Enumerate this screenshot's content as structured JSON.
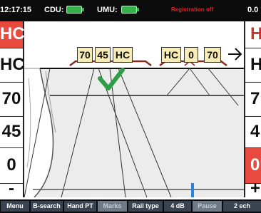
{
  "status": {
    "time": "12:17:15",
    "cdu_label": "CDU:",
    "umu_label": "UMU:",
    "registration": "Registration off",
    "right_value": "0.0",
    "colors": {
      "bar_bg": "#0c0c0c",
      "battery": "#32b44b",
      "registration_text": "#e02424"
    }
  },
  "left_channels": [
    {
      "label": "HC",
      "selected": true
    },
    {
      "label": "HC",
      "selected": false
    },
    {
      "label": "70",
      "selected": false
    },
    {
      "label": "45",
      "selected": false
    },
    {
      "label": "0",
      "selected": false
    },
    {
      "label": "-",
      "selected": false
    }
  ],
  "right_channels": [
    {
      "label": "H",
      "selected": false
    },
    {
      "label": "H",
      "selected": false
    },
    {
      "label": "7",
      "selected": false
    },
    {
      "label": "4",
      "selected": false
    },
    {
      "label": "0",
      "selected": true
    },
    {
      "label": "+",
      "selected": false
    }
  ],
  "scan": {
    "left_group_tags": [
      "70",
      "45",
      "HC"
    ],
    "right_group_tags": [
      "HC",
      "0",
      "70"
    ],
    "direction_icon": "right-arrow-icon",
    "status_icon": "checkmark-icon",
    "colors": {
      "tag_bg": "#f7ecb6",
      "checkmark": "#2e9e47",
      "bracket": "#8b2a1e",
      "position_marker": "#2b83d9",
      "selected_cell": "#e94a3f"
    }
  },
  "toolbar": {
    "buttons": [
      {
        "label": "Menu",
        "enabled": true
      },
      {
        "label": "B-search",
        "enabled": true
      },
      {
        "label": "Hand PT",
        "enabled": true
      },
      {
        "label": "Marks",
        "enabled": false
      },
      {
        "label": "Rail type",
        "enabled": true
      },
      {
        "label": "4 dB",
        "enabled": true
      },
      {
        "label": "Pause",
        "enabled": false
      },
      {
        "label": "2 ech",
        "enabled": true
      }
    ]
  }
}
